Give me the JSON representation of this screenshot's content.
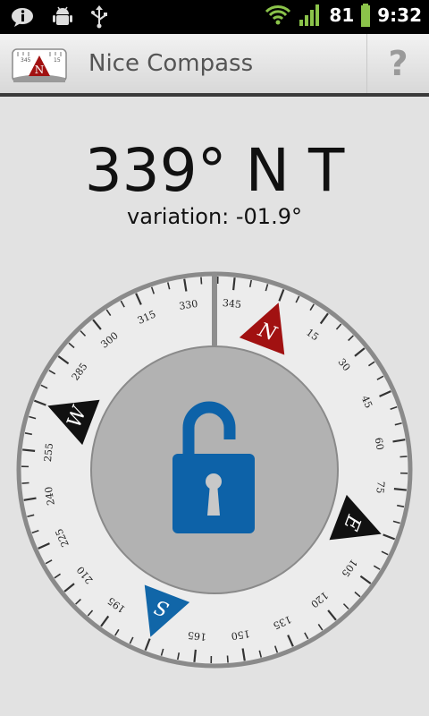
{
  "status_bar": {
    "battery_level": "81",
    "time": "9:32",
    "icons": [
      "info-icon",
      "android-debug-icon",
      "usb-icon",
      "wifi-icon",
      "signal-icon",
      "battery-icon"
    ]
  },
  "title_bar": {
    "app_name": "Nice Compass",
    "help_label": "?",
    "app_icon_letter": "N",
    "app_icon_tick_labels": [
      "345",
      "15"
    ]
  },
  "heading": {
    "text": "339° N T",
    "variation": "variation: -01.9°"
  },
  "compass": {
    "heading_degrees": 339,
    "tick_labels": [
      "15",
      "30",
      "45",
      "60",
      "75",
      "105",
      "120",
      "135",
      "150",
      "165",
      "195",
      "210",
      "225",
      "240",
      "255",
      "285",
      "300",
      "315",
      "330",
      "345"
    ],
    "cardinals": {
      "north": "N",
      "east": "E",
      "south": "S",
      "west": "W"
    },
    "colors": {
      "north_marker": "#a11111",
      "south_marker": "#1166a8",
      "side_marker": "#111111",
      "lock": "#0d62a8",
      "inner_disc": "#b2b2b2",
      "dial_face": "#ececec"
    },
    "lock_state": "unlocked"
  }
}
